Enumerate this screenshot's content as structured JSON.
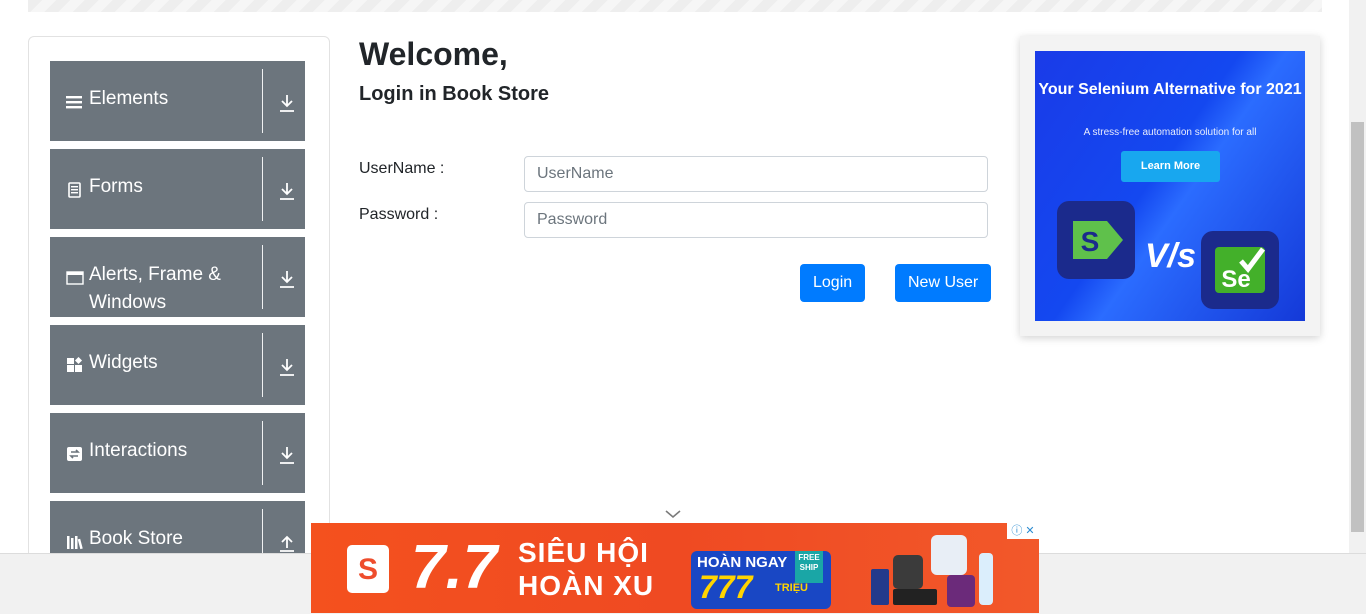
{
  "sidebar": {
    "groups": [
      {
        "label": "Elements",
        "icon": "menu-lines-icon",
        "toggle": "download-arrow-icon"
      },
      {
        "label": "Forms",
        "icon": "document-icon",
        "toggle": "download-arrow-icon"
      },
      {
        "label": "Alerts, Frame & Windows",
        "icon": "browser-window-icon",
        "toggle": "download-arrow-icon"
      },
      {
        "label": "Widgets",
        "icon": "widgets-grid-icon",
        "toggle": "download-arrow-icon"
      },
      {
        "label": "Interactions",
        "icon": "swap-arrows-icon",
        "toggle": "download-arrow-icon"
      },
      {
        "label": "Book Store",
        "icon": "books-icon",
        "toggle": "upload-arrow-icon"
      }
    ]
  },
  "main": {
    "title": "Welcome,",
    "subtitle": "Login in Book Store",
    "username_label": "UserName :",
    "username_placeholder": "UserName",
    "password_label": "Password :",
    "password_placeholder": "Password",
    "login_button": "Login",
    "new_user_button": "New User"
  },
  "side_ad": {
    "headline": "Your Selenium Alternative for 2021",
    "tagline": "A stress-free automation solution for all",
    "cta": "Learn More",
    "vs_text": "V/s",
    "logo_left": "S",
    "logo_right": "Se"
  },
  "bottom_ad": {
    "bag_letter": "S",
    "big_number": "7.7",
    "line1": "SIÊU HỘI",
    "line2": "HOÀN XU",
    "box_title": "HOÀN NGAY",
    "box_amount": "777",
    "box_unit": "TRIỆU",
    "free_ship": "FREE SHIP"
  },
  "colors": {
    "sidebar_group_bg": "#6c757d",
    "primary_button": "#007bff",
    "ad_blue": "#1448f0",
    "shopee_orange": "#ef4a22"
  }
}
